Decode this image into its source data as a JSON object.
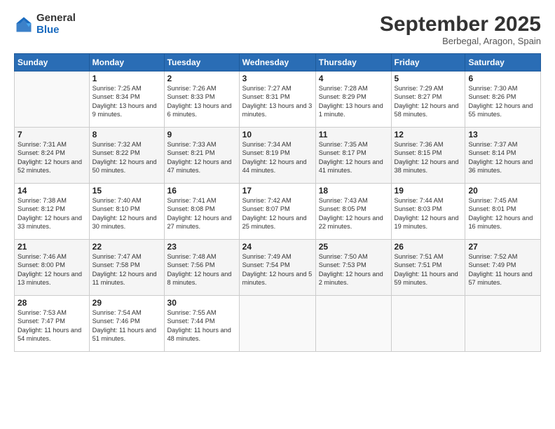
{
  "logo": {
    "general": "General",
    "blue": "Blue"
  },
  "title": "September 2025",
  "subtitle": "Berbegal, Aragon, Spain",
  "days_header": [
    "Sunday",
    "Monday",
    "Tuesday",
    "Wednesday",
    "Thursday",
    "Friday",
    "Saturday"
  ],
  "weeks": [
    [
      {
        "num": "",
        "sunrise": "",
        "sunset": "",
        "daylight": ""
      },
      {
        "num": "1",
        "sunrise": "Sunrise: 7:25 AM",
        "sunset": "Sunset: 8:34 PM",
        "daylight": "Daylight: 13 hours and 9 minutes."
      },
      {
        "num": "2",
        "sunrise": "Sunrise: 7:26 AM",
        "sunset": "Sunset: 8:33 PM",
        "daylight": "Daylight: 13 hours and 6 minutes."
      },
      {
        "num": "3",
        "sunrise": "Sunrise: 7:27 AM",
        "sunset": "Sunset: 8:31 PM",
        "daylight": "Daylight: 13 hours and 3 minutes."
      },
      {
        "num": "4",
        "sunrise": "Sunrise: 7:28 AM",
        "sunset": "Sunset: 8:29 PM",
        "daylight": "Daylight: 13 hours and 1 minute."
      },
      {
        "num": "5",
        "sunrise": "Sunrise: 7:29 AM",
        "sunset": "Sunset: 8:27 PM",
        "daylight": "Daylight: 12 hours and 58 minutes."
      },
      {
        "num": "6",
        "sunrise": "Sunrise: 7:30 AM",
        "sunset": "Sunset: 8:26 PM",
        "daylight": "Daylight: 12 hours and 55 minutes."
      }
    ],
    [
      {
        "num": "7",
        "sunrise": "Sunrise: 7:31 AM",
        "sunset": "Sunset: 8:24 PM",
        "daylight": "Daylight: 12 hours and 52 minutes."
      },
      {
        "num": "8",
        "sunrise": "Sunrise: 7:32 AM",
        "sunset": "Sunset: 8:22 PM",
        "daylight": "Daylight: 12 hours and 50 minutes."
      },
      {
        "num": "9",
        "sunrise": "Sunrise: 7:33 AM",
        "sunset": "Sunset: 8:21 PM",
        "daylight": "Daylight: 12 hours and 47 minutes."
      },
      {
        "num": "10",
        "sunrise": "Sunrise: 7:34 AM",
        "sunset": "Sunset: 8:19 PM",
        "daylight": "Daylight: 12 hours and 44 minutes."
      },
      {
        "num": "11",
        "sunrise": "Sunrise: 7:35 AM",
        "sunset": "Sunset: 8:17 PM",
        "daylight": "Daylight: 12 hours and 41 minutes."
      },
      {
        "num": "12",
        "sunrise": "Sunrise: 7:36 AM",
        "sunset": "Sunset: 8:15 PM",
        "daylight": "Daylight: 12 hours and 38 minutes."
      },
      {
        "num": "13",
        "sunrise": "Sunrise: 7:37 AM",
        "sunset": "Sunset: 8:14 PM",
        "daylight": "Daylight: 12 hours and 36 minutes."
      }
    ],
    [
      {
        "num": "14",
        "sunrise": "Sunrise: 7:38 AM",
        "sunset": "Sunset: 8:12 PM",
        "daylight": "Daylight: 12 hours and 33 minutes."
      },
      {
        "num": "15",
        "sunrise": "Sunrise: 7:40 AM",
        "sunset": "Sunset: 8:10 PM",
        "daylight": "Daylight: 12 hours and 30 minutes."
      },
      {
        "num": "16",
        "sunrise": "Sunrise: 7:41 AM",
        "sunset": "Sunset: 8:08 PM",
        "daylight": "Daylight: 12 hours and 27 minutes."
      },
      {
        "num": "17",
        "sunrise": "Sunrise: 7:42 AM",
        "sunset": "Sunset: 8:07 PM",
        "daylight": "Daylight: 12 hours and 25 minutes."
      },
      {
        "num": "18",
        "sunrise": "Sunrise: 7:43 AM",
        "sunset": "Sunset: 8:05 PM",
        "daylight": "Daylight: 12 hours and 22 minutes."
      },
      {
        "num": "19",
        "sunrise": "Sunrise: 7:44 AM",
        "sunset": "Sunset: 8:03 PM",
        "daylight": "Daylight: 12 hours and 19 minutes."
      },
      {
        "num": "20",
        "sunrise": "Sunrise: 7:45 AM",
        "sunset": "Sunset: 8:01 PM",
        "daylight": "Daylight: 12 hours and 16 minutes."
      }
    ],
    [
      {
        "num": "21",
        "sunrise": "Sunrise: 7:46 AM",
        "sunset": "Sunset: 8:00 PM",
        "daylight": "Daylight: 12 hours and 13 minutes."
      },
      {
        "num": "22",
        "sunrise": "Sunrise: 7:47 AM",
        "sunset": "Sunset: 7:58 PM",
        "daylight": "Daylight: 12 hours and 11 minutes."
      },
      {
        "num": "23",
        "sunrise": "Sunrise: 7:48 AM",
        "sunset": "Sunset: 7:56 PM",
        "daylight": "Daylight: 12 hours and 8 minutes."
      },
      {
        "num": "24",
        "sunrise": "Sunrise: 7:49 AM",
        "sunset": "Sunset: 7:54 PM",
        "daylight": "Daylight: 12 hours and 5 minutes."
      },
      {
        "num": "25",
        "sunrise": "Sunrise: 7:50 AM",
        "sunset": "Sunset: 7:53 PM",
        "daylight": "Daylight: 12 hours and 2 minutes."
      },
      {
        "num": "26",
        "sunrise": "Sunrise: 7:51 AM",
        "sunset": "Sunset: 7:51 PM",
        "daylight": "Daylight: 11 hours and 59 minutes."
      },
      {
        "num": "27",
        "sunrise": "Sunrise: 7:52 AM",
        "sunset": "Sunset: 7:49 PM",
        "daylight": "Daylight: 11 hours and 57 minutes."
      }
    ],
    [
      {
        "num": "28",
        "sunrise": "Sunrise: 7:53 AM",
        "sunset": "Sunset: 7:47 PM",
        "daylight": "Daylight: 11 hours and 54 minutes."
      },
      {
        "num": "29",
        "sunrise": "Sunrise: 7:54 AM",
        "sunset": "Sunset: 7:46 PM",
        "daylight": "Daylight: 11 hours and 51 minutes."
      },
      {
        "num": "30",
        "sunrise": "Sunrise: 7:55 AM",
        "sunset": "Sunset: 7:44 PM",
        "daylight": "Daylight: 11 hours and 48 minutes."
      },
      {
        "num": "",
        "sunrise": "",
        "sunset": "",
        "daylight": ""
      },
      {
        "num": "",
        "sunrise": "",
        "sunset": "",
        "daylight": ""
      },
      {
        "num": "",
        "sunrise": "",
        "sunset": "",
        "daylight": ""
      },
      {
        "num": "",
        "sunrise": "",
        "sunset": "",
        "daylight": ""
      }
    ]
  ]
}
